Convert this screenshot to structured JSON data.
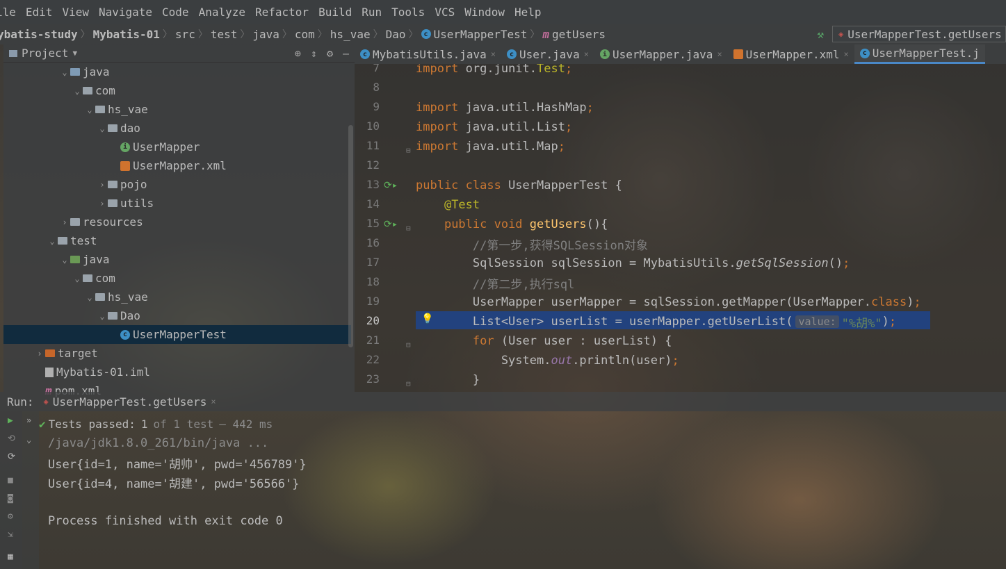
{
  "menu": [
    "ile",
    "Edit",
    "View",
    "Navigate",
    "Code",
    "Analyze",
    "Refactor",
    "Build",
    "Run",
    "Tools",
    "VCS",
    "Window",
    "Help"
  ],
  "breadcrumb": {
    "project": "ybatis-study",
    "module": "Mybatis-01",
    "items": [
      "src",
      "test",
      "java",
      "com",
      "hs_vae",
      "Dao",
      "UserMapperTest",
      "getUsers"
    ]
  },
  "run_config": "UserMapperTest.getUsers",
  "project_panel": {
    "title": "Project",
    "tree": [
      {
        "label": "java",
        "arrow": "⌄",
        "icon": "folder-blue",
        "indent": 80
      },
      {
        "label": "com",
        "arrow": "⌄",
        "icon": "folder-gray",
        "indent": 98
      },
      {
        "label": "hs_vae",
        "arrow": "⌄",
        "icon": "folder-gray",
        "indent": 116
      },
      {
        "label": "dao",
        "arrow": "⌄",
        "icon": "folder-gray",
        "indent": 134
      },
      {
        "label": "UserMapper",
        "arrow": "",
        "icon": "interface",
        "indent": 152
      },
      {
        "label": "UserMapper.xml",
        "arrow": "",
        "icon": "xml",
        "indent": 152
      },
      {
        "label": "pojo",
        "arrow": "›",
        "icon": "folder-gray",
        "indent": 134
      },
      {
        "label": "utils",
        "arrow": "›",
        "icon": "folder-gray",
        "indent": 134
      },
      {
        "label": "resources",
        "arrow": "›",
        "icon": "folder-gray",
        "indent": 80
      },
      {
        "label": "test",
        "arrow": "⌄",
        "icon": "folder-gray",
        "indent": 62
      },
      {
        "label": "java",
        "arrow": "⌄",
        "icon": "folder-green",
        "indent": 80
      },
      {
        "label": "com",
        "arrow": "⌄",
        "icon": "folder-gray",
        "indent": 98
      },
      {
        "label": "hs_vae",
        "arrow": "⌄",
        "icon": "folder-gray",
        "indent": 116
      },
      {
        "label": "Dao",
        "arrow": "⌄",
        "icon": "folder-gray",
        "indent": 134
      },
      {
        "label": "UserMapperTest",
        "arrow": "",
        "icon": "class",
        "indent": 152,
        "selected": true
      },
      {
        "label": "target",
        "arrow": "›",
        "icon": "folder-orange",
        "indent": 44
      },
      {
        "label": "Mybatis-01.iml",
        "arrow": "",
        "icon": "iml",
        "indent": 44
      },
      {
        "label": "pom.xml",
        "arrow": "",
        "icon": "maven",
        "indent": 44
      }
    ]
  },
  "tabs": [
    {
      "label": "MybatisUtils.java",
      "icon": "class"
    },
    {
      "label": "User.java",
      "icon": "class"
    },
    {
      "label": "UserMapper.java",
      "icon": "interface"
    },
    {
      "label": "UserMapper.xml",
      "icon": "xml"
    },
    {
      "label": "UserMapperTest.j",
      "icon": "class",
      "active": true
    }
  ],
  "editor": {
    "line_numbers": [
      "7",
      "8",
      "9",
      "10",
      "11",
      "12",
      "13",
      "14",
      "15",
      "16",
      "17",
      "18",
      "19",
      "20",
      "21",
      "22",
      "23"
    ],
    "param_hint": "value:",
    "comments": [
      "//第一步,获得SQLSession对象",
      "//第二步,执行sql"
    ],
    "string_literal": "\"%胡%\""
  },
  "run": {
    "label": "Run:",
    "tab": "UserMapperTest.getUsers",
    "status_passed": "Tests passed:",
    "status_count": "1",
    "status_of": "of 1 test",
    "status_time": "— 442 ms",
    "console": [
      "/java/jdk1.8.0_261/bin/java ...",
      "User{id=1, name='胡帅', pwd='456789'}",
      "User{id=4, name='胡建', pwd='56566'}",
      "",
      "Process finished with exit code 0"
    ]
  },
  "colors": {
    "selection": "#0d293e",
    "highlight": "#214283",
    "keyword": "#cc7832",
    "annotation": "#bbb529",
    "function": "#ffc66d",
    "comment": "#808080",
    "string": "#6a8759",
    "tab_accent": "#4a88c7"
  }
}
